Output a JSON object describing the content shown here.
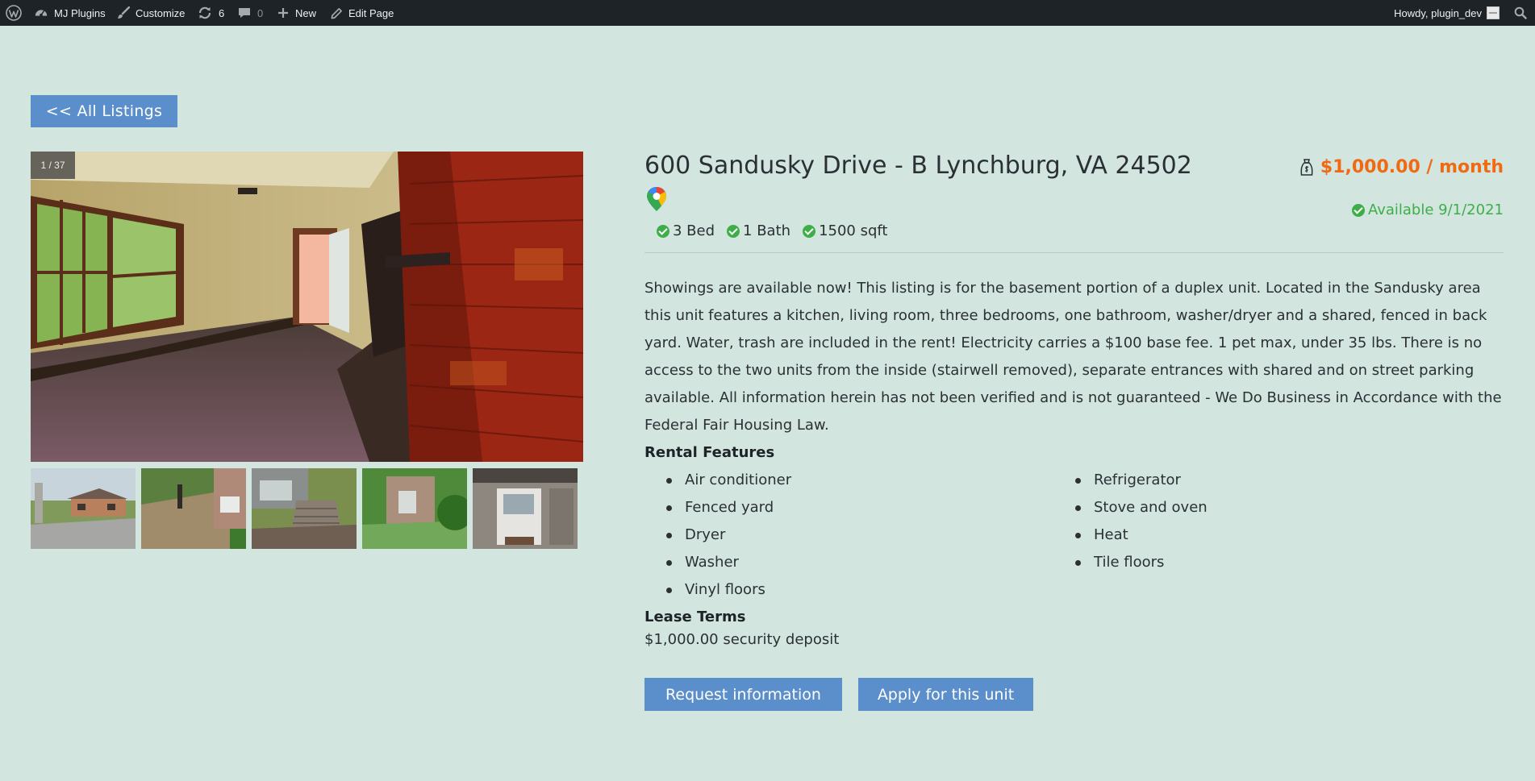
{
  "admin_bar": {
    "site_name": "MJ Plugins",
    "customize": "Customize",
    "updates_count": "6",
    "comments_count": "0",
    "new_label": "New",
    "edit_page": "Edit Page",
    "howdy": "Howdy, plugin_dev"
  },
  "back_button": "<< All Listings",
  "gallery": {
    "counter": "1 / 37",
    "main_image": "interior living room with brick fireplace",
    "thumbnails": [
      "house exterior front",
      "backyard patio",
      "basement entrance stairs",
      "side yard entrance",
      "front door"
    ]
  },
  "listing": {
    "address": "600 Sandusky Drive - B Lynchburg, VA 24502",
    "price": "$1,000.00 / month",
    "availability": "Available 9/1/2021",
    "stats": [
      "3 Bed",
      "1 Bath",
      "1500 sqft"
    ],
    "description": "Showings are available now! This listing is for the basement portion of a duplex unit. Located in the Sandusky area this unit features a kitchen, living room, three bedrooms, one bathroom, washer/dryer and a shared, fenced in back yard. Water, trash are included in the rent! Electricity carries a $100 base fee. 1 pet max, under 35 lbs. There is no access to the two units from the inside (stairwell removed), separate entrances with shared and on street parking available. All information herein has not been verified and is not guaranteed - We Do Business in Accordance with the Federal Fair Housing Law.",
    "features_title": "Rental Features",
    "features_left": [
      "Air conditioner",
      "Fenced yard",
      "Dryer",
      "Washer",
      "Vinyl floors"
    ],
    "features_right": [
      "Refrigerator",
      "Stove and oven",
      "Heat",
      "Tile floors"
    ],
    "lease_title": "Lease Terms",
    "lease_text": "$1,000.00 security deposit",
    "request_button": "Request information",
    "apply_button": "Apply for this unit"
  },
  "colors": {
    "background": "#d2e5df",
    "accent_button": "#5b8fcb",
    "price": "#f06a13",
    "available": "#3fae49",
    "admin_bar": "#1d2327"
  }
}
